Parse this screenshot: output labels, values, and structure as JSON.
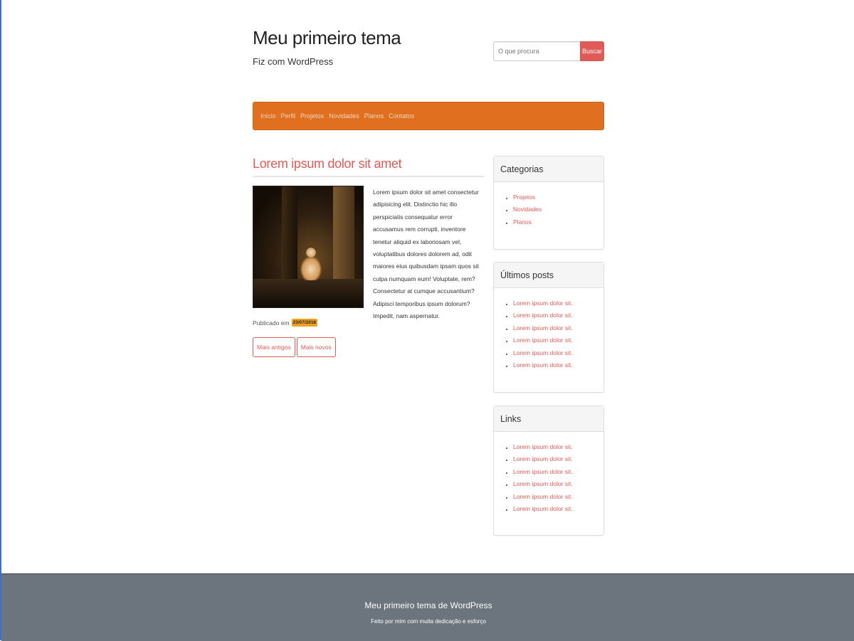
{
  "header": {
    "site_title": "Meu primeiro tema",
    "site_description": "Fiz com WordPress"
  },
  "search": {
    "placeholder": "O que procura",
    "button_label": "Buscar"
  },
  "nav": {
    "items": [
      {
        "label": "Início"
      },
      {
        "label": "Perfil"
      },
      {
        "label": "Projetos"
      },
      {
        "label": "Novidades"
      },
      {
        "label": "Planos"
      },
      {
        "label": "Contatos"
      }
    ]
  },
  "post": {
    "title": "Lorem ipsum dolor sit amet",
    "excerpt": "Lorem ipsum dolor sit amet consectetur adipisicing elit. Distinctio hic illo perspiciatis consequatur error accusamus rem corrupti, inventore tenetur aliquid ex laboriosam vel, voluptatibus dolores dolorem ad, odit maiores eius quibusdam ipsam quos sit culpa numquam eum! Voluptate, rem? Consectetur at cumque accusantium? Adipisci temporibus ipsum dolorum? Impedit, nam aspernatur.",
    "published_label": "Publicado em",
    "date": "23/07/2018"
  },
  "pager": {
    "older_label": "Mais antigos",
    "newer_label": "Mais novos"
  },
  "sidebar": {
    "categories": {
      "title": "Categorias",
      "items": [
        "Projetos",
        "Novidades",
        "Planos"
      ]
    },
    "recent_posts": {
      "title": "Últimos posts",
      "items": [
        "Lorem ipsum dolor sit.",
        "Lorem ipsum dolor sit.",
        "Lorem ipsum dolor sit.",
        "Lorem ipsum dolor sit.",
        "Lorem ipsum dolor sit.",
        "Lorem ipsum dolor sit."
      ]
    },
    "links": {
      "title": "Links",
      "items": [
        "Lorem ipsum dolor sit.",
        "Lorem ipsum dolor sit.",
        "Lorem ipsum dolor sit.",
        "Lorem ipsum dolor sit.",
        "Lorem ipsum dolor sit.",
        "Lorem ipsum dolor sit."
      ]
    }
  },
  "footer": {
    "title": "Meu primeiro tema de WordPress",
    "subtitle": "Feito por mim com muita dedicação e esforço"
  },
  "colors": {
    "accent": "#e05a57",
    "navbar": "#e07020",
    "footer": "#6c757d",
    "date_badge": "#f0a020"
  }
}
